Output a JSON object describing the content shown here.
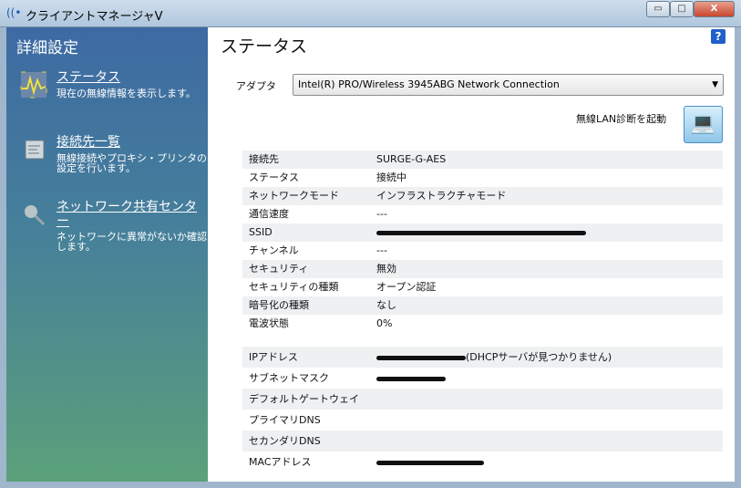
{
  "window": {
    "title": "クライアントマネージャV",
    "minimize": "▭",
    "maximize": "□",
    "close": "X"
  },
  "sidebar": {
    "heading": "詳細設定",
    "items": [
      {
        "label": "ステータス",
        "desc": "現在の無線情報を表示します。",
        "icon": "status-wave-icon"
      },
      {
        "label": "接続先一覧",
        "desc": "無線接続やプロキシ・プリンタの設定を行います。",
        "icon": "list-window-icon"
      },
      {
        "label": "ネットワーク共有センター",
        "desc": "ネットワークに異常がないか確認します。",
        "icon": "magnifier-icon"
      }
    ]
  },
  "main": {
    "title": "ステータス",
    "help": "?",
    "adapter_label": "アダプタ",
    "adapter_value": "Intel(R) PRO/Wireless 3945ABG Network Connection",
    "diag_label": "無線LAN診断を起動",
    "info": [
      {
        "k": "接続先",
        "v": "SURGE-G-AES"
      },
      {
        "k": "ステータス",
        "v": "接続中"
      },
      {
        "k": "ネットワークモード",
        "v": "インフラストラクチャモード"
      },
      {
        "k": "通信速度",
        "v": "---"
      },
      {
        "k": "SSID",
        "v": ""
      },
      {
        "k": "チャンネル",
        "v": "---"
      },
      {
        "k": "セキュリティ",
        "v": "無効"
      },
      {
        "k": "セキュリティの種類",
        "v": "オープン認証"
      },
      {
        "k": "暗号化の種類",
        "v": "なし"
      },
      {
        "k": "電波状態",
        "v": "0%"
      }
    ],
    "net": [
      {
        "k": "IPアドレス",
        "v": "(DHCPサーバが見つかりません)"
      },
      {
        "k": "サブネットマスク",
        "v": ""
      },
      {
        "k": "デフォルトゲートウェイ",
        "v": ""
      },
      {
        "k": "プライマリDNS",
        "v": ""
      },
      {
        "k": "セカンダリDNS",
        "v": ""
      },
      {
        "k": "MACアドレス",
        "v": ""
      }
    ]
  }
}
